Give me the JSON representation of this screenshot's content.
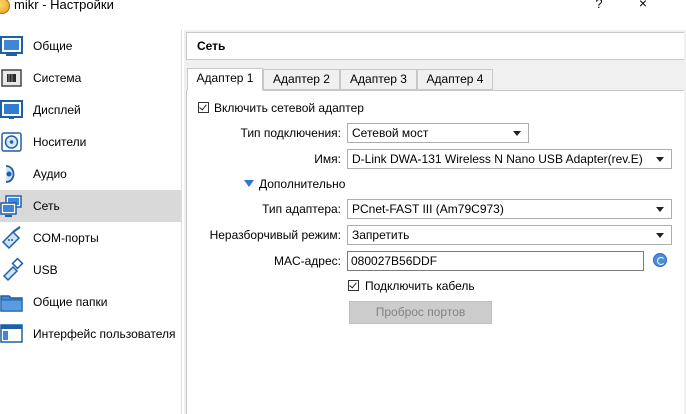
{
  "window": {
    "title": "mikr - Настройки",
    "help_label": "?",
    "close_label": "×"
  },
  "sidebar": {
    "items": [
      {
        "label": "Общие",
        "icon": "general-icon"
      },
      {
        "label": "Система",
        "icon": "system-icon"
      },
      {
        "label": "Дисплей",
        "icon": "display-icon"
      },
      {
        "label": "Носители",
        "icon": "storage-icon"
      },
      {
        "label": "Аудио",
        "icon": "audio-icon"
      },
      {
        "label": "Сеть",
        "icon": "network-icon",
        "selected": true
      },
      {
        "label": "COM-порты",
        "icon": "serial-ports-icon"
      },
      {
        "label": "USB",
        "icon": "usb-icon"
      },
      {
        "label": "Общие папки",
        "icon": "shared-folders-icon"
      },
      {
        "label": "Интерфейс пользователя",
        "icon": "user-interface-icon"
      }
    ]
  },
  "main": {
    "section_title": "Сеть",
    "tabs": [
      {
        "label": "Адаптер 1",
        "active": true
      },
      {
        "label": "Адаптер 2",
        "active": false
      },
      {
        "label": "Адаптер 3",
        "active": false
      },
      {
        "label": "Адаптер 4",
        "active": false
      }
    ],
    "enable_adapter": {
      "label": "Включить сетевой адаптер",
      "checked": true
    },
    "attached_to": {
      "label": "Тип подключения:",
      "value": "Сетевой мост"
    },
    "name": {
      "label": "Имя:",
      "value": "D-Link DWA-131 Wireless N Nano USB Adapter(rev.E)"
    },
    "advanced_label": "Дополнительно",
    "adapter_type": {
      "label": "Тип адаптера:",
      "value": "PCnet-FAST III (Am79C973)"
    },
    "promiscuous_mode": {
      "label": "Неразборчивый режим:",
      "value": "Запретить"
    },
    "mac_address": {
      "label": "MAC-адрес:",
      "value": "080027B56DDF"
    },
    "cable_connected": {
      "label": "Подключить кабель",
      "checked": true
    },
    "port_forwarding_label": "Проброс портов"
  },
  "colors": {
    "selected_item_bg": "#d9d9d9",
    "content_bg": "#f0f0f0",
    "accent": "#2d79d6"
  }
}
